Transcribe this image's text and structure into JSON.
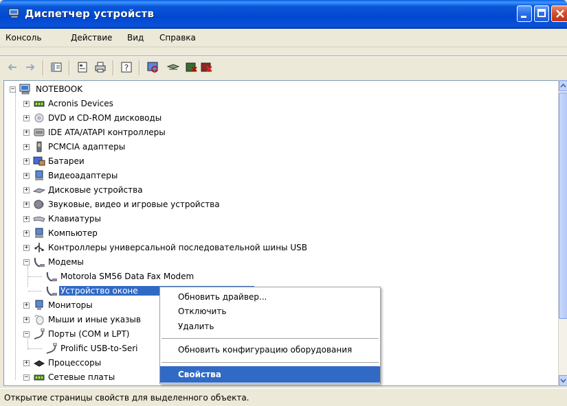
{
  "window": {
    "title": "Диспетчер устройств"
  },
  "menubar": {
    "items": [
      "Консоль",
      "Действие",
      "Вид",
      "Справка"
    ]
  },
  "toolbar": {
    "buttons": [
      "back-icon",
      "forward-icon",
      "show-hide-tree-icon",
      "properties-icon",
      "print-icon",
      "help-icon",
      "scan-hardware-icon",
      "update-driver-icon",
      "disable-icon",
      "uninstall-icon"
    ]
  },
  "tree": {
    "root": "NOTEBOOK",
    "items": [
      {
        "label": "Acronis Devices",
        "icon": "network-card-icon"
      },
      {
        "label": "DVD и CD-ROM дисководы",
        "icon": "cdrom-icon"
      },
      {
        "label": "IDE ATA/ATAPI контроллеры",
        "icon": "ide-controller-icon"
      },
      {
        "label": "PCMCIA адаптеры",
        "icon": "pcmcia-icon"
      },
      {
        "label": "Батареи",
        "icon": "battery-icon"
      },
      {
        "label": "Видеоадаптеры",
        "icon": "display-adapter-icon"
      },
      {
        "label": "Дисковые устройства",
        "icon": "disk-drive-icon"
      },
      {
        "label": "Звуковые, видео и игровые устройства",
        "icon": "sound-icon"
      },
      {
        "label": "Клавиатуры",
        "icon": "keyboard-icon"
      },
      {
        "label": "Компьютер",
        "icon": "computer-icon"
      },
      {
        "label": "Контроллеры универсальной последовательной шины USB",
        "icon": "usb-icon"
      },
      {
        "label": "Модемы",
        "icon": "modem-icon"
      },
      {
        "label": "Motorola SM56 Data Fax Modem",
        "icon": "modem-icon"
      },
      {
        "label": "Устройство оконе",
        "icon": "modem-icon"
      },
      {
        "label": "Мониторы",
        "icon": "monitor-icon"
      },
      {
        "label": "Мыши и иные указыв",
        "icon": "mouse-icon"
      },
      {
        "label": "Порты (COM и LPT)",
        "icon": "port-icon"
      },
      {
        "label": "Prolific USB-to-Seri",
        "icon": "port-icon"
      },
      {
        "label": "Процессоры",
        "icon": "processor-icon"
      },
      {
        "label": "Сетевые платы",
        "icon": "network-card-icon"
      }
    ]
  },
  "context_menu": {
    "items": [
      "Обновить драйвер...",
      "Отключить",
      "Удалить",
      "Обновить конфигурацию оборудования",
      "Свойства"
    ]
  },
  "statusbar": {
    "text": "Открытие страницы свойств для выделенного объекта."
  },
  "colors": {
    "selection": "#316ac5",
    "titlebar": "#0a56d8"
  }
}
